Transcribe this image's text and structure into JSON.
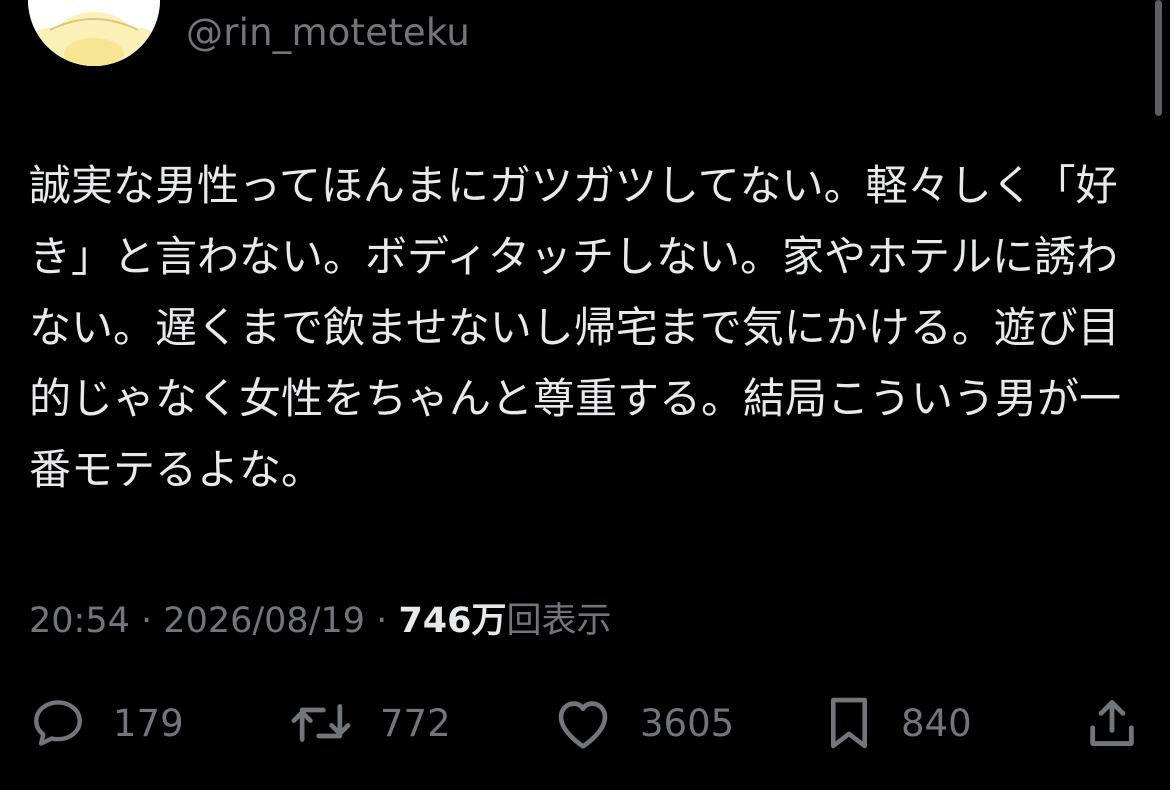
{
  "profile": {
    "handle": "@rin_moteteku",
    "avatar_icon": "yellow-character-avatar"
  },
  "tweet": {
    "text": "誠実な男性ってほんまにガツガツしてない。軽々しく「好き」と言わない。ボディタッチしない。家やホテルに誘わない。遅くまで飲ませないし帰宅まで気にかける。遊び目的じゃなく女性をちゃんと尊重する。結局こういう男が一番モテるよな。"
  },
  "meta": {
    "time": "20:54",
    "separator": "·",
    "date": "2026/08/19",
    "views_count": "746万",
    "views_label": "回表示"
  },
  "actions": {
    "reply": {
      "icon": "reply-bubble-icon",
      "count": "179"
    },
    "retweet": {
      "icon": "retweet-icon",
      "count": "772"
    },
    "like": {
      "icon": "heart-icon",
      "count": "3605"
    },
    "bookmark": {
      "icon": "bookmark-icon",
      "count": "840"
    },
    "share": {
      "icon": "share-icon"
    }
  },
  "colors": {
    "background": "#000000",
    "primary_text": "#e7e9ea",
    "secondary_text": "#71767b"
  }
}
